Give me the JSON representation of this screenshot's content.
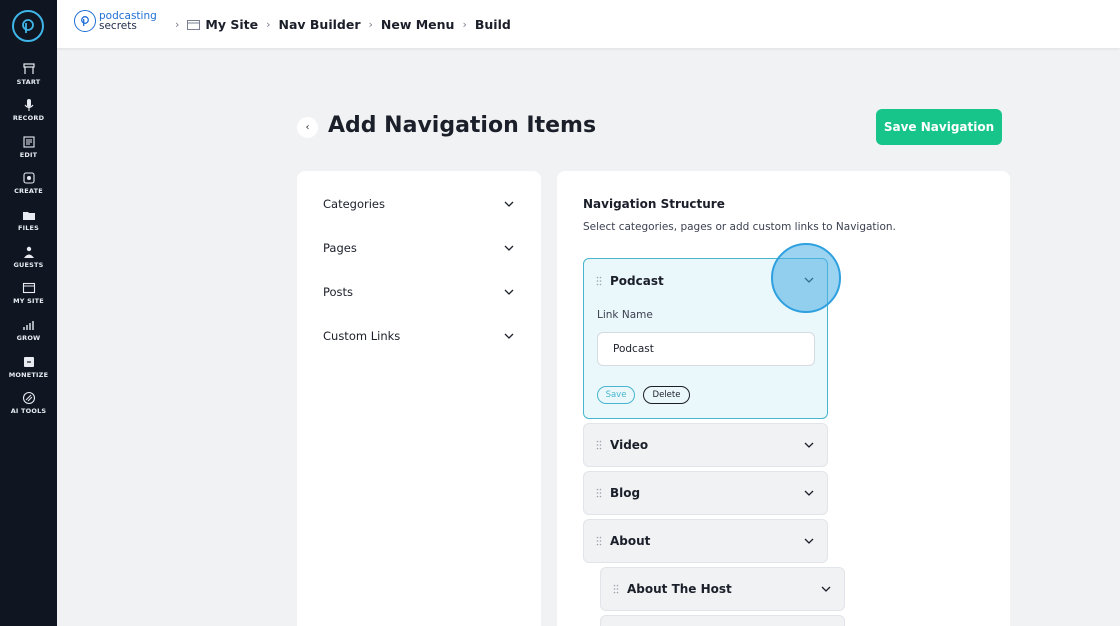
{
  "rail": {
    "items": [
      {
        "label": "START",
        "icon": "start-icon"
      },
      {
        "label": "RECORD",
        "icon": "microphone-icon"
      },
      {
        "label": "EDIT",
        "icon": "edit-icon"
      },
      {
        "label": "CREATE",
        "icon": "create-icon"
      },
      {
        "label": "FILES",
        "icon": "files-icon"
      },
      {
        "label": "GUESTS",
        "icon": "guests-icon"
      },
      {
        "label": "MY SITE",
        "icon": "my-site-icon"
      },
      {
        "label": "GROW",
        "icon": "grow-icon"
      },
      {
        "label": "MONETIZE",
        "icon": "monetize-icon"
      },
      {
        "label": "AI TOOLS",
        "icon": "ai-tools-icon"
      }
    ]
  },
  "brand": {
    "line1": "podcasting",
    "line2": "secrets"
  },
  "breadcrumb": [
    "My Site",
    "Nav Builder",
    "New Menu",
    "Build"
  ],
  "header": {
    "title": "Add Navigation Items",
    "save_label": "Save Navigation"
  },
  "sources": [
    "Categories",
    "Pages",
    "Posts",
    "Custom Links"
  ],
  "structure": {
    "title": "Navigation Structure",
    "subtitle": "Select categories, pages or add custom links to Navigation.",
    "open_item": {
      "label": "Podcast",
      "field_label": "Link Name",
      "field_value": "Podcast",
      "save_label": "Save",
      "delete_label": "Delete"
    },
    "items": [
      "Video",
      "Blog",
      "About"
    ],
    "child_items": [
      "About The Host"
    ]
  },
  "colors": {
    "accent": "#17c48a",
    "highlight": "#48b6cf",
    "rail_bg": "#0f1521"
  }
}
